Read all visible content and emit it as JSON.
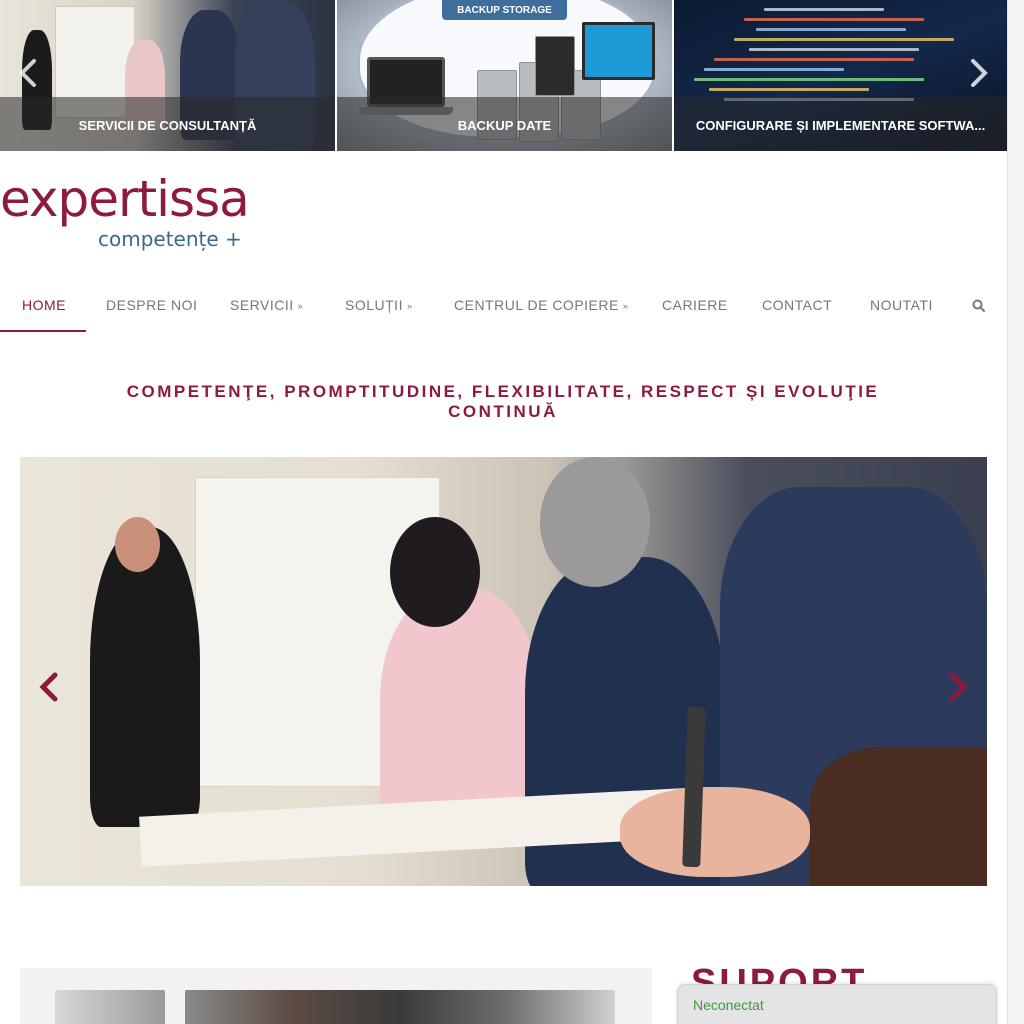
{
  "top_carousel": {
    "slides": [
      {
        "caption": "SERVICII DE CONSULTANȚĂ"
      },
      {
        "caption": "BACKUP DATE",
        "image_label": "BACKUP STORAGE"
      },
      {
        "caption": "CONFIGURARE ȘI IMPLEMENTARE SOFTWA..."
      }
    ]
  },
  "logo": {
    "main": "expertissa",
    "sub": "competențe +"
  },
  "nav": {
    "items": [
      {
        "label": "HOME",
        "active": true
      },
      {
        "label": "DESPRE NOI"
      },
      {
        "label": "SERVICII",
        "dropdown": true
      },
      {
        "label": "SOLUȚII",
        "dropdown": true
      },
      {
        "label": "CENTRUL DE COPIERE",
        "dropdown": true
      },
      {
        "label": "CARIERE"
      },
      {
        "label": "CONTACT"
      },
      {
        "label": "NOUTATI"
      }
    ],
    "search_icon": "search-icon"
  },
  "tagline": "COMPETENŢE, PROMPTITUDINE, FLEXIBILITATE, RESPECT ȘI EVOLUŢIE CONTINUĂ",
  "suport_heading": "SUPORT",
  "chat": {
    "status": "Neconectat"
  },
  "colors": {
    "brand": "#8c1b3e",
    "logo_sub": "#3a6a86",
    "online_status": "#3b9a3b"
  }
}
